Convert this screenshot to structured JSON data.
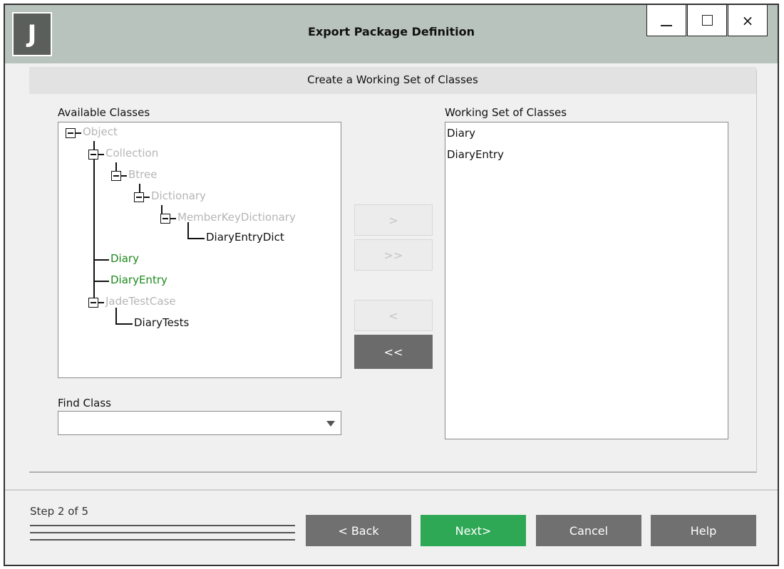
{
  "window": {
    "title": "Export Package Definition",
    "logo_letter": "J",
    "controls": {
      "minimize": "minimize",
      "maximize": "maximize",
      "close": "×"
    }
  },
  "panel": {
    "header": "Create a Working Set of Classes",
    "available_label": "Available Classes",
    "working_label": "Working Set of Classes",
    "find_label": "Find Class",
    "find_value": ""
  },
  "tree": {
    "nodes": [
      {
        "label": "Object",
        "state": "unavailable"
      },
      {
        "label": "Collection",
        "state": "unavailable"
      },
      {
        "label": "Btree",
        "state": "unavailable"
      },
      {
        "label": "Dictionary",
        "state": "unavailable"
      },
      {
        "label": "MemberKeyDictionary",
        "state": "unavailable"
      },
      {
        "label": "DiaryEntryDict",
        "state": "available"
      },
      {
        "label": "Diary",
        "state": "selected"
      },
      {
        "label": "DiaryEntry",
        "state": "selected"
      },
      {
        "label": "JadeTestCase",
        "state": "unavailable"
      },
      {
        "label": "DiaryTests",
        "state": "available"
      }
    ]
  },
  "working_set": [
    "Diary",
    "DiaryEntry"
  ],
  "move_buttons": {
    "add": ">",
    "add_all": ">>",
    "remove": "<",
    "remove_all": "<<"
  },
  "footer": {
    "step": "Step 2 of 5",
    "back": "< Back",
    "next": "Next>",
    "cancel": "Cancel",
    "help": "Help"
  },
  "colors": {
    "titlebar": "#b9c3bd",
    "selected_class": "#1c8a1c",
    "unavailable_class": "#b5b5b5",
    "next_button": "#2ea855",
    "footer_button": "#707070"
  }
}
